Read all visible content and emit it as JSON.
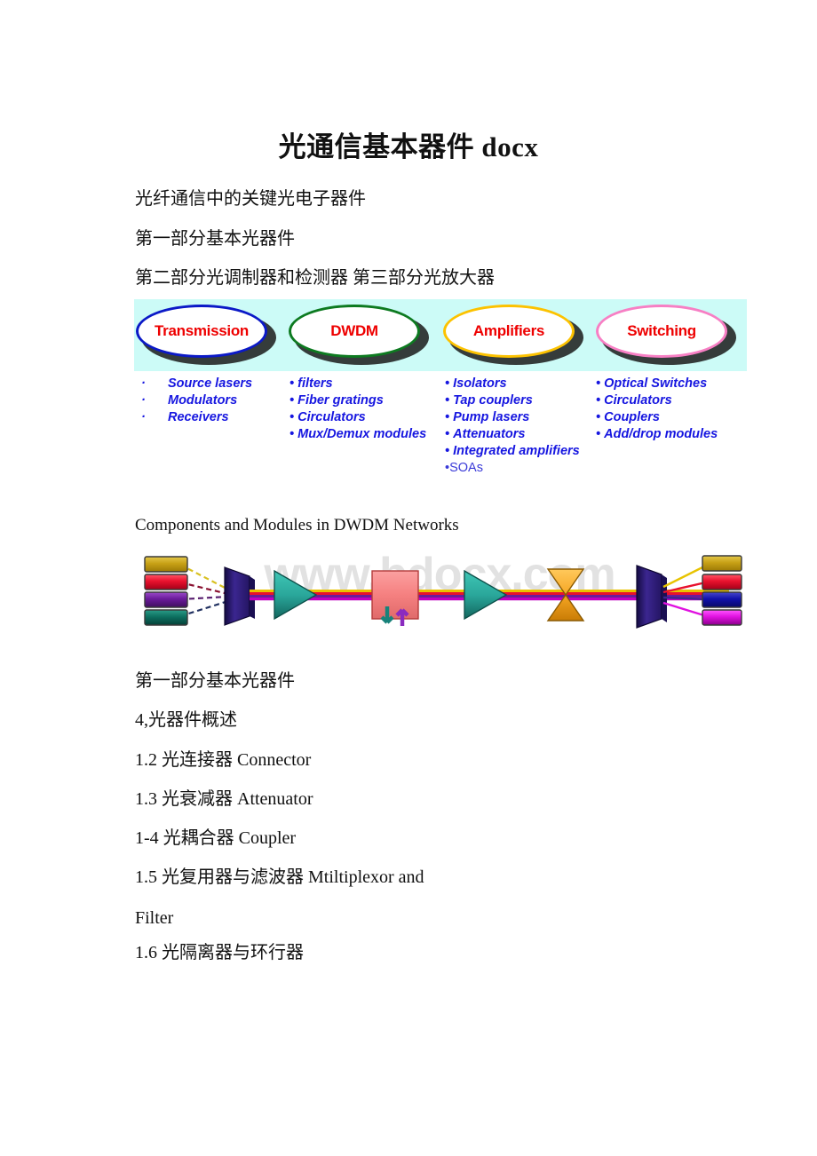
{
  "document": {
    "title": "光通信基本器件 docx",
    "paragraphs": [
      "光纤通信中的关键光电子器件",
      "第一部分基本光器件",
      "第二部分光调制器和检测器 第三部分光放大器"
    ],
    "figure1_caption": "Components and Modules in DWDM Networks",
    "lower_lines": [
      "第一部分基本光器件",
      "4,光器件概述",
      "1.2 光连接器 Connector",
      "1.3 光衰减器 Attenuator",
      "1-4 光耦合器 Coupler",
      "1.5 光复用器与滤波器 Mtiltiplexor and",
      "Filter",
      "1.6 光隔离器与环行器"
    ]
  },
  "figure1": {
    "band_color": "#ccfbf7",
    "ellipses": [
      {
        "label": "Transmission",
        "border_color": "#0b19c7",
        "text_color": "#ee0000"
      },
      {
        "label": "DWDM",
        "border_color": "#0d7a20",
        "text_color": "#ee0000"
      },
      {
        "label": "Amplifiers",
        "border_color": "#fcc200",
        "text_color": "#ee0000"
      },
      {
        "label": "Switching",
        "border_color": "#f77fc4",
        "text_color": "#ee0000"
      }
    ],
    "columns": [
      {
        "name": "transmission",
        "clipped": true,
        "items": [
          "Source lasers",
          "Modulators",
          "Receivers"
        ]
      },
      {
        "name": "dwdm",
        "clipped": false,
        "items": [
          "filters",
          "Fiber gratings",
          "Circulators",
          "Mux/Demux modules"
        ]
      },
      {
        "name": "amplifiers",
        "clipped": false,
        "items": [
          "Isolators",
          "Tap couplers",
          "Pump lasers",
          "Attenuators",
          "Integrated amplifiers"
        ],
        "plain_item": "SOAs"
      },
      {
        "name": "switching",
        "clipped": false,
        "items": [
          "Optical Switches",
          "Circulators",
          "Couplers",
          "Add/drop modules"
        ]
      }
    ],
    "text_color": "#1616e0"
  },
  "figure2": {
    "watermark": "www.bdocx.com",
    "transmitters": [
      "#c8a116",
      "#e8112d",
      "#6a1b9a",
      "#0d7060"
    ],
    "receivers": [
      "#c8a116",
      "#e8112d",
      "#1111aa",
      "#e011e0"
    ],
    "mux_color": "#2a1a6e",
    "demux_color": "#2a1a6e",
    "amplifier_color": "#2aa79b",
    "adddrop_color": "#f58080",
    "attenuator_color": "#f5a623",
    "fiber_colors": [
      "#e8c300",
      "#e8112d",
      "#6a1b9a",
      "#c000c0"
    ]
  }
}
